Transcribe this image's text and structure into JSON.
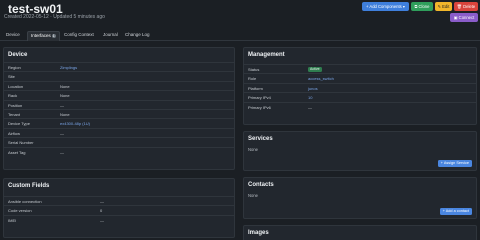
{
  "header": {
    "title": "test-sw01",
    "subtitle": "Created 2022-05-12 · Updated 5 minutes ago"
  },
  "actions": {
    "add_components": "Add Components",
    "clone": "Clone",
    "edit": "Edit",
    "delete": "Delete",
    "connect": "Connect"
  },
  "tabs": [
    {
      "label": "Device"
    },
    {
      "label": "Interfaces",
      "count": "1"
    },
    {
      "label": "Config Context"
    },
    {
      "label": "Journal"
    },
    {
      "label": "Change Log"
    }
  ],
  "device": {
    "title": "Device",
    "rows": [
      {
        "k": "Region",
        "v": "Zimplings"
      },
      {
        "k": "Site",
        "v": ""
      },
      {
        "k": "Location",
        "v": "None"
      },
      {
        "k": "Rack",
        "v": "None"
      },
      {
        "k": "Position",
        "v": "—"
      },
      {
        "k": "Tenant",
        "v": "None"
      },
      {
        "k": "Device Type",
        "v": "ex4300-48p (1U)"
      },
      {
        "k": "Airflow",
        "v": "—"
      },
      {
        "k": "Serial Number",
        "v": ""
      },
      {
        "k": "Asset Tag",
        "v": "—"
      }
    ]
  },
  "management": {
    "title": "Management",
    "rows": [
      {
        "k": "Status",
        "v": "Active"
      },
      {
        "k": "Role",
        "v": "access_switch"
      },
      {
        "k": "Platform",
        "v": "junos"
      },
      {
        "k": "Primary IPv4",
        "v": "10"
      },
      {
        "k": "Primary IPv6",
        "v": "—"
      }
    ]
  },
  "services": {
    "title": "Services",
    "none": "None",
    "button": "Assign Service"
  },
  "contacts": {
    "title": "Contacts",
    "none": "None",
    "button": "Add a contact"
  },
  "custom_fields": {
    "title": "Custom Fields",
    "rows": [
      {
        "k": "Ansible connection",
        "v": "—"
      },
      {
        "k": "Code version",
        "v": "0"
      },
      {
        "k": "IMEI",
        "v": "—"
      }
    ]
  },
  "images": {
    "title": "Images"
  },
  "colors": {
    "add_components": "#3f7fdc",
    "clone": "#2f9e5b",
    "edit": "#f1b62b",
    "delete": "#d9443c",
    "connect": "#8a5cc9"
  }
}
